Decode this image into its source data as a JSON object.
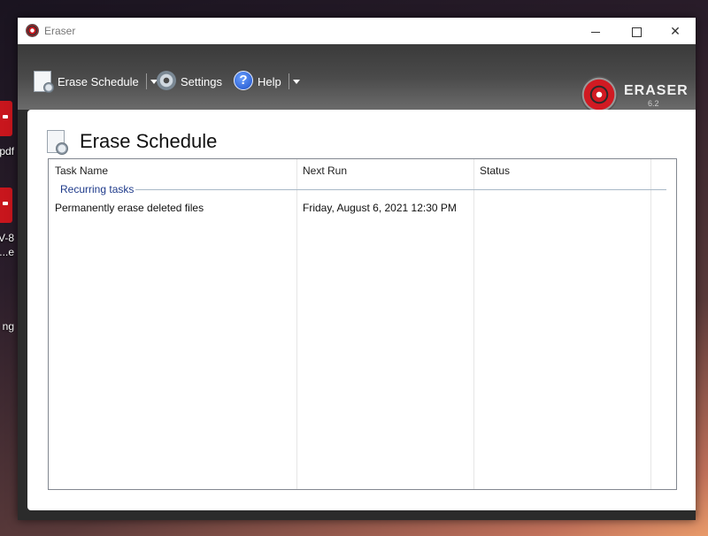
{
  "window": {
    "title": "Eraser"
  },
  "desktop": {
    "label1": "pdf",
    "label2": "V-8",
    "label3": "e...",
    "label4": "ng"
  },
  "toolbar": {
    "erase_schedule": "Erase Schedule",
    "settings": "Settings",
    "help": "Help"
  },
  "logo": {
    "name": "ERASER",
    "version": "6.2"
  },
  "page": {
    "title": "Erase Schedule"
  },
  "table": {
    "columns": [
      "Task Name",
      "Next Run",
      "Status"
    ],
    "group": "Recurring tasks",
    "rows": [
      {
        "task_name": "Permanently erase deleted files",
        "next_run": "Friday, August 6, 2021 12:30 PM",
        "status": ""
      }
    ]
  },
  "colors": {
    "accent_red": "#c8161d",
    "group_text": "#1e3a8a"
  }
}
